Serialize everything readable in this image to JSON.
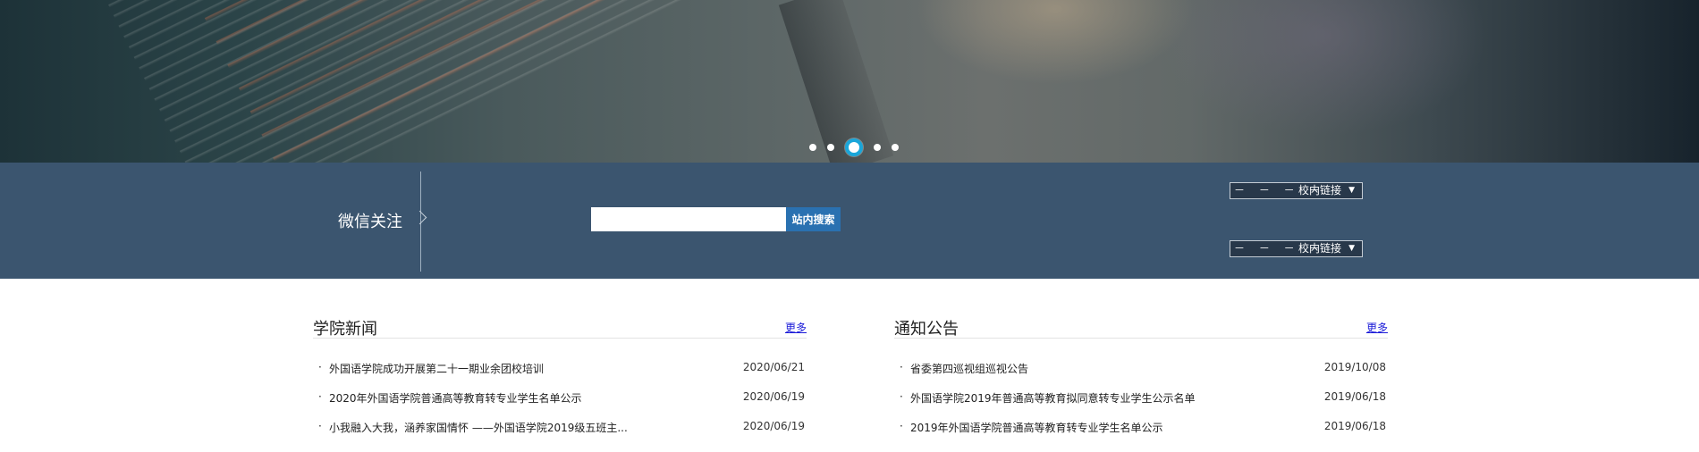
{
  "banner": {
    "slide_count": 5,
    "active_slide": 3
  },
  "toolbar": {
    "wechat_label": "微信关注",
    "search_placeholder": "",
    "search_button": "站内搜索",
    "selects": [
      {
        "dashes": "－ － － －",
        "label": "校内链接"
      },
      {
        "dashes": "－ － － －",
        "label": "校内链接"
      }
    ]
  },
  "news": {
    "title": "学院新闻",
    "more": "更多",
    "items": [
      {
        "bullet": "·",
        "title": "外国语学院成功开展第二十一期业余团校培训",
        "date": "2020/06/21"
      },
      {
        "bullet": "·",
        "title": "2020年外国语学院普通高等教育转专业学生名单公示",
        "date": "2020/06/19"
      },
      {
        "bullet": "·",
        "title": "小我融入大我，涵养家国情怀 ——外国语学院2019级五班主...",
        "date": "2020/06/19"
      }
    ]
  },
  "notice": {
    "title": "通知公告",
    "more": "更多",
    "items": [
      {
        "bullet": "·",
        "title": "省委第四巡视组巡视公告",
        "date": "2019/10/08"
      },
      {
        "bullet": "·",
        "title": "外国语学院2019年普通高等教育拟同意转专业学生公示名单",
        "date": "2019/06/18"
      },
      {
        "bullet": "·",
        "title": "2019年外国语学院普通高等教育转专业学生名单公示",
        "date": "2019/06/18"
      }
    ]
  },
  "colors": {
    "bar_background": "#3b556f",
    "search_button": "#2a71b1",
    "active_dot_ring": "#1aa6d9",
    "more_link": "#1a1ad8"
  }
}
